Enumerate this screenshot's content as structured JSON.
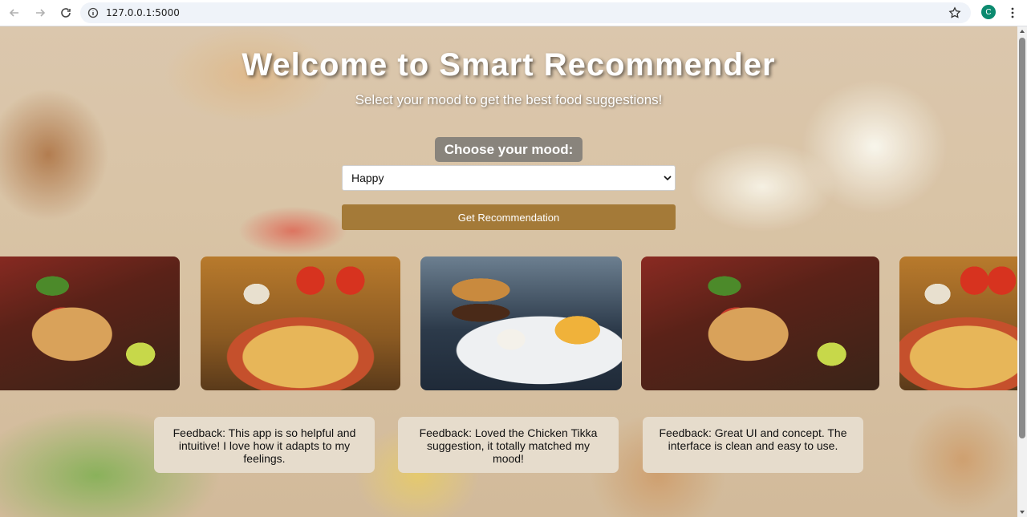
{
  "browser": {
    "url": "127.0.0.1:5000",
    "profile_initial": "C"
  },
  "hero": {
    "title": "Welcome to Smart Recommender",
    "subtitle": "Select your mood to get the best food suggestions!"
  },
  "form": {
    "mood_label": "Choose your mood:",
    "selected_mood": "Happy",
    "button_label": "Get Recommendation"
  },
  "gallery": [
    {
      "dish": "wrap"
    },
    {
      "dish": "pizza"
    },
    {
      "dish": "burger"
    },
    {
      "dish": "wrap"
    },
    {
      "dish": "pizza"
    }
  ],
  "feedback": [
    {
      "text": "Feedback: This app is so helpful and intuitive! I love how it adapts to my feelings."
    },
    {
      "text": "Feedback: Loved the Chicken Tikka suggestion, it totally matched my mood!"
    },
    {
      "text": "Feedback: Great UI and concept. The interface is clean and easy to use."
    }
  ],
  "colors": {
    "button": "#a47a38",
    "feedback_card": "#e6dccc",
    "profile": "#0b8a6f"
  }
}
